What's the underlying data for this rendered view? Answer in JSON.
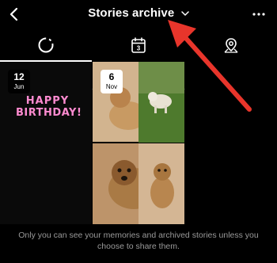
{
  "header": {
    "title": "Stories archive",
    "icons": {
      "back": "back-chevron-icon",
      "dropdown": "chevron-down-icon",
      "more": "more-dots-icon"
    }
  },
  "tabs": [
    {
      "name": "stories-archive",
      "icon": "circle-dashed-icon",
      "selected": true
    },
    {
      "name": "calendar",
      "icon": "calendar-icon",
      "calendar_number": "3",
      "selected": false
    },
    {
      "name": "map",
      "icon": "map-pin-icon",
      "selected": false
    }
  ],
  "grid": {
    "items": [
      {
        "date_day": "12",
        "date_month": "Jun",
        "sticker_line1": "HAPPY",
        "sticker_line2": "BIRTHDAY!"
      },
      {
        "date_day": "6",
        "date_month": "Nov"
      }
    ]
  },
  "footer": {
    "text": "Only you can see your memories and archived stories unless you choose to share them."
  },
  "colors": {
    "background": "#000000",
    "annotation_arrow": "#e8352b",
    "birthday_text": "#ff8bd0"
  }
}
